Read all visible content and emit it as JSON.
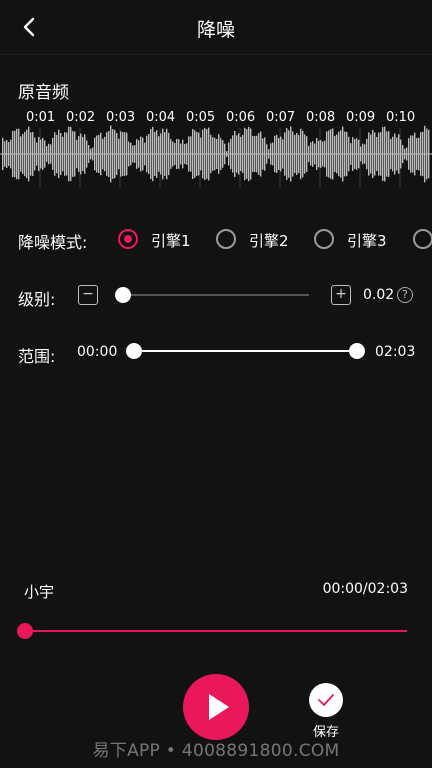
{
  "header": {
    "title": "降噪",
    "back_icon": "back-chevron-icon"
  },
  "waveform": {
    "label": "原音频",
    "ticks": [
      "0:01",
      "0:02",
      "0:03",
      "0:04",
      "0:05",
      "0:06",
      "0:07",
      "0:08",
      "0:09",
      "0:10"
    ],
    "color": "#bdbdbd"
  },
  "noise_mode": {
    "label": "降噪模式:",
    "options": [
      "引擎1",
      "引擎2",
      "引擎3"
    ],
    "selected": "引擎1"
  },
  "level": {
    "label": "级别:",
    "minus": "−",
    "plus": "+",
    "value": "0.02",
    "fraction": 0.0,
    "help": "?"
  },
  "range": {
    "label": "范围:",
    "start": "00:00",
    "end": "02:03"
  },
  "player": {
    "song_name": "小宇",
    "time": "00:00/02:03",
    "progress_fraction": 0.0
  },
  "actions": {
    "save_label": "保存"
  },
  "watermark": "易下APP • 4008891800.COM",
  "colors": {
    "accent": "#e8185a",
    "background": "#121212"
  }
}
